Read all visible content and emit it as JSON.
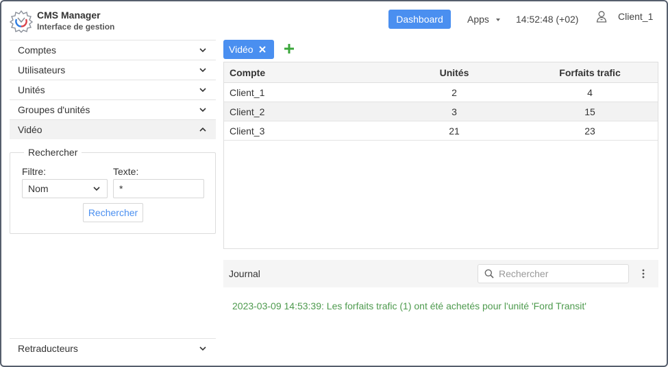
{
  "brand": {
    "title": "CMS Manager",
    "subtitle": "Interface de gestion"
  },
  "header": {
    "dashboard_label": "Dashboard",
    "apps_label": "Apps",
    "clock": "14:52:48 (+02)",
    "user": "Client_1"
  },
  "sidebar": {
    "items": [
      {
        "label": "Comptes"
      },
      {
        "label": "Utilisateurs"
      },
      {
        "label": "Unités"
      },
      {
        "label": "Groupes d'unités"
      },
      {
        "label": "Vidéo"
      }
    ],
    "bottom_item": "Retraducteurs"
  },
  "search_panel": {
    "legend": "Rechercher",
    "filter_label": "Filtre:",
    "filter_value": "Nom",
    "text_label": "Texte:",
    "text_value": "*",
    "button_label": "Rechercher"
  },
  "tabs": [
    {
      "label": "Vidéo"
    }
  ],
  "table": {
    "headers": [
      "Compte",
      "Unités",
      "Forfaits trafic"
    ],
    "rows": [
      [
        "Client_1",
        "2",
        "4"
      ],
      [
        "Client_2",
        "3",
        "15"
      ],
      [
        "Client_3",
        "21",
        "23"
      ]
    ]
  },
  "journal": {
    "title": "Journal",
    "search_placeholder": "Rechercher",
    "entries": [
      "2023-03-09 14:53:39: Les forfaits trafic (1) ont été achetés pour l'unité 'Ford Transit'"
    ]
  },
  "colors": {
    "accent": "#4a8ff0",
    "add": "#3aa63a",
    "log_text": "#4d9a4d"
  },
  "icons": {
    "logo": "gear-logo-icon",
    "user": "user-icon",
    "chevron": "chevron-down-icon",
    "chevron_open": "chevron-up-icon",
    "close": "close-icon",
    "add": "plus-icon",
    "search": "search-icon",
    "menu": "kebab-menu-icon"
  }
}
